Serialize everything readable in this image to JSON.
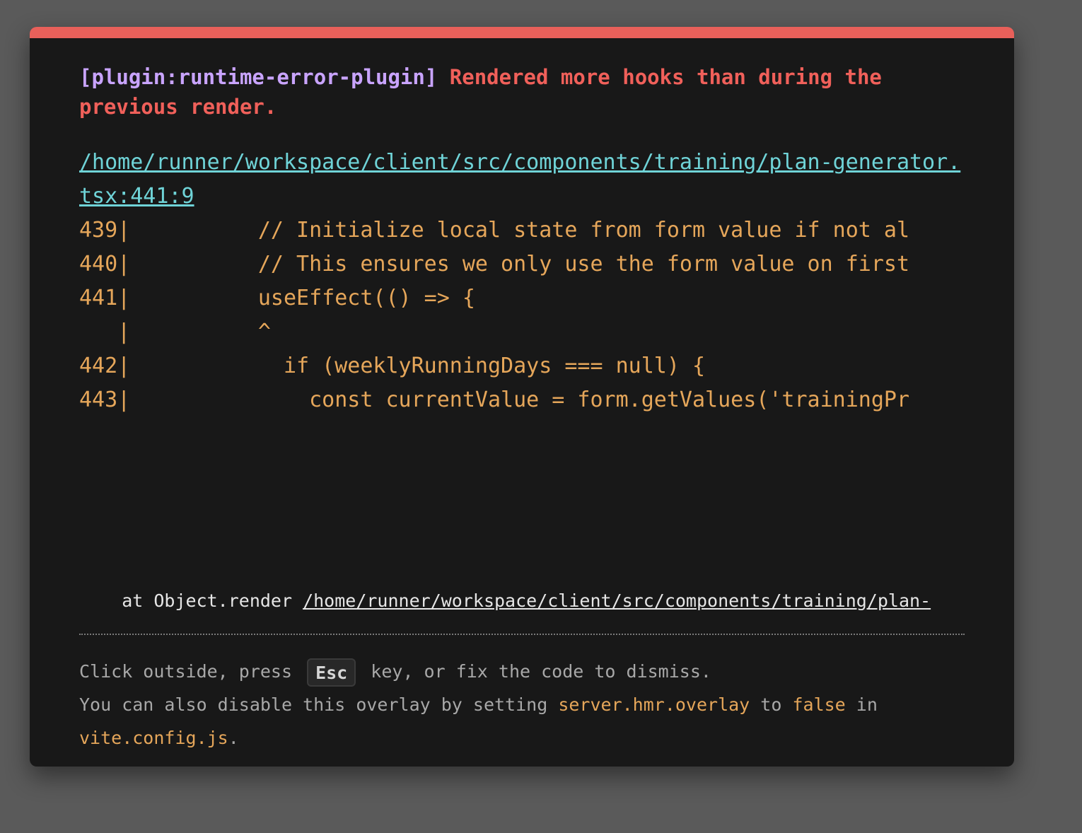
{
  "error": {
    "plugin_tag": "[plugin:runtime-error-plugin]",
    "message": "Rendered more hooks than during the previous render.",
    "file_link": "/home/runner/workspace/client/src/components/training/plan-generator.tsx:441:9"
  },
  "code_frame": {
    "lines": [
      "439|          // Initialize local state from form value if not al",
      "440|          // This ensures we only use the form value on first",
      "441|          useEffect(() => {",
      "   |          ^",
      "442|            if (weeklyRunningDays === null) {",
      "443|              const currentValue = form.getValues('trainingPr"
    ]
  },
  "stack": {
    "prefix": "    at Object.render ",
    "link": "/home/runner/workspace/client/src/components/training/plan-"
  },
  "tip": {
    "line1_before": "Click outside, press ",
    "esc_key": "Esc",
    "line1_after": " key, or fix the code to dismiss.",
    "line2_before": "You can also disable this overlay by setting ",
    "config_key": "server.hmr.overlay",
    "line2_middle": " to ",
    "false_value": "false",
    "line2_after": " in",
    "config_file": "vite.config.js",
    "line3_after": "."
  },
  "colors": {
    "accent_bar": "#e8605a",
    "plugin": "#c9a4ff",
    "message": "#f0605a",
    "file_link": "#6fd3d7",
    "code": "#e5a65a",
    "background": "#181818"
  }
}
